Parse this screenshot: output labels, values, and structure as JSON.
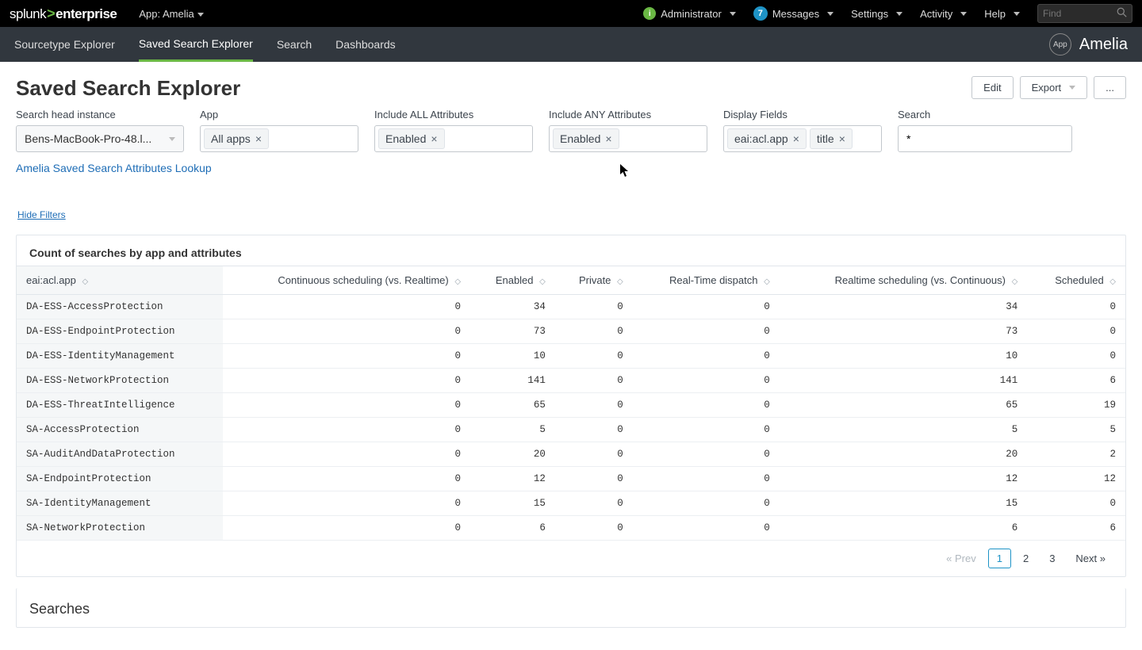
{
  "topbar": {
    "logo_prefix": "splunk",
    "logo_suffix": "enterprise",
    "app_switch": "App: Amelia",
    "admin": "Administrator",
    "messages": "Messages",
    "messages_count": "7",
    "settings": "Settings",
    "activity": "Activity",
    "help": "Help",
    "find_placeholder": "Find"
  },
  "navbar": {
    "tabs": [
      {
        "label": "Sourcetype Explorer"
      },
      {
        "label": "Saved Search Explorer"
      },
      {
        "label": "Search"
      },
      {
        "label": "Dashboards"
      }
    ],
    "app_badge": "App",
    "app_name": "Amelia"
  },
  "page": {
    "title": "Saved Search Explorer",
    "edit": "Edit",
    "export": "Export",
    "more": "..."
  },
  "filters": {
    "search_head": {
      "label": "Search head instance",
      "value": "Bens-MacBook-Pro-48.l..."
    },
    "app": {
      "label": "App",
      "tokens": [
        "All apps"
      ]
    },
    "include_all": {
      "label": "Include ALL Attributes",
      "tokens": [
        "Enabled"
      ]
    },
    "include_any": {
      "label": "Include ANY Attributes",
      "tokens": [
        "Enabled"
      ]
    },
    "display_fields": {
      "label": "Display Fields",
      "tokens": [
        "eai:acl.app",
        "title"
      ]
    },
    "search": {
      "label": "Search",
      "value": "*"
    }
  },
  "lookup_link": "Amelia Saved Search Attributes Lookup",
  "hide_filters": "Hide Filters",
  "panel": {
    "title": "Count of searches by app and attributes",
    "columns": [
      "eai:acl.app",
      "Continuous scheduling (vs. Realtime)",
      "Enabled",
      "Private",
      "Real-Time dispatch",
      "Realtime scheduling (vs. Continuous)",
      "Scheduled"
    ],
    "rows": [
      {
        "app": "DA-ESS-AccessProtection",
        "c": [
          0,
          34,
          0,
          0,
          34,
          0
        ]
      },
      {
        "app": "DA-ESS-EndpointProtection",
        "c": [
          0,
          73,
          0,
          0,
          73,
          0
        ]
      },
      {
        "app": "DA-ESS-IdentityManagement",
        "c": [
          0,
          10,
          0,
          0,
          10,
          0
        ]
      },
      {
        "app": "DA-ESS-NetworkProtection",
        "c": [
          0,
          141,
          0,
          0,
          141,
          6
        ]
      },
      {
        "app": "DA-ESS-ThreatIntelligence",
        "c": [
          0,
          65,
          0,
          0,
          65,
          19
        ]
      },
      {
        "app": "SA-AccessProtection",
        "c": [
          0,
          5,
          0,
          0,
          5,
          5
        ]
      },
      {
        "app": "SA-AuditAndDataProtection",
        "c": [
          0,
          20,
          0,
          0,
          20,
          2
        ]
      },
      {
        "app": "SA-EndpointProtection",
        "c": [
          0,
          12,
          0,
          0,
          12,
          12
        ]
      },
      {
        "app": "SA-IdentityManagement",
        "c": [
          0,
          15,
          0,
          0,
          15,
          0
        ]
      },
      {
        "app": "SA-NetworkProtection",
        "c": [
          0,
          6,
          0,
          0,
          6,
          6
        ]
      }
    ]
  },
  "pagination": {
    "prev": "« Prev",
    "pages": [
      "1",
      "2",
      "3"
    ],
    "next": "Next »"
  },
  "searches_title": "Searches"
}
